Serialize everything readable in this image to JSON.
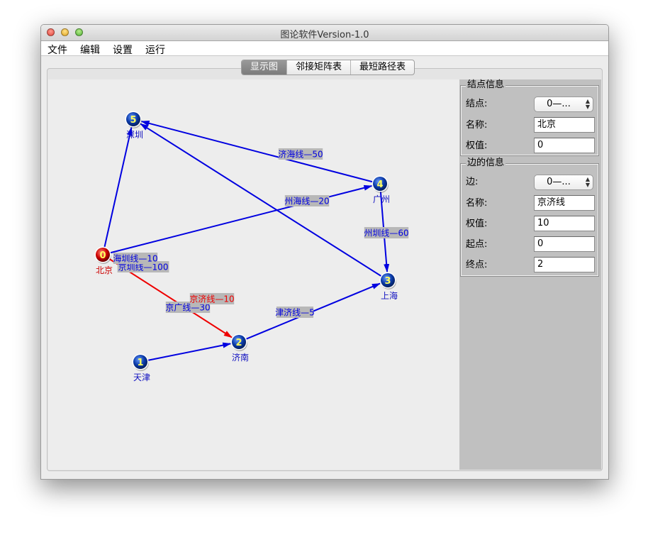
{
  "window": {
    "title": "图论软件Version-1.0"
  },
  "menu": [
    "文件",
    "编辑",
    "设置",
    "运行"
  ],
  "tabs": [
    "显示图",
    "邻接矩阵表",
    "最短路径表"
  ],
  "active_tab": 0,
  "nodes": [
    {
      "id": "0",
      "name": "北京",
      "color": "#cc0000",
      "label_color": "#cc0000"
    },
    {
      "id": "1",
      "name": "天津",
      "color": "#0a3aa8",
      "label_color": "#1010c0"
    },
    {
      "id": "2",
      "name": "济南",
      "color": "#0a3aa8",
      "label_color": "#1010c0"
    },
    {
      "id": "3",
      "name": "上海",
      "color": "#0a3aa8",
      "label_color": "#1010c0"
    },
    {
      "id": "4",
      "name": "广州",
      "color": "#0a3aa8",
      "label_color": "#1010c0"
    },
    {
      "id": "5",
      "name": "深圳",
      "color": "#0a3aa8",
      "label_color": "#1010c0"
    }
  ],
  "edges": [
    {
      "from": 0,
      "to": 5,
      "label": "京圳线—100",
      "selected": false
    },
    {
      "from": 0,
      "to": 4,
      "label": "京广线—30",
      "selected": false
    },
    {
      "from": 0,
      "to": 2,
      "label": "京济线—10",
      "selected": true
    },
    {
      "from": 1,
      "to": 2,
      "label": "津济线—5",
      "selected": false
    },
    {
      "from": 2,
      "to": 3,
      "label": "济海线—50",
      "selected": false
    },
    {
      "from": 4,
      "to": 3,
      "label": "州海线—20",
      "selected": false
    },
    {
      "from": 4,
      "to": 5,
      "label": "州圳线—60",
      "selected": false
    },
    {
      "from": 3,
      "to": 5,
      "label": "海圳线—10",
      "selected": false
    }
  ],
  "colors": {
    "edge": "#0000e0",
    "selected_edge": "#ee0000",
    "edge_label_bg": "#b8b8b8",
    "node_digit": "#ffff60"
  },
  "node_info": {
    "title": "结点信息",
    "node_label": "结点:",
    "node_value": "0—...",
    "name_label": "名称:",
    "name_value": "北京",
    "weight_label": "权值:",
    "weight_value": "0"
  },
  "edge_info": {
    "title": "边的信息",
    "edge_label": "边:",
    "edge_value": "0—...",
    "name_label": "名称:",
    "name_value": "京济线",
    "weight_label": "权值:",
    "weight_value": "10",
    "start_label": "起点:",
    "start_value": "0",
    "end_label": "终点:",
    "end_value": "2"
  }
}
